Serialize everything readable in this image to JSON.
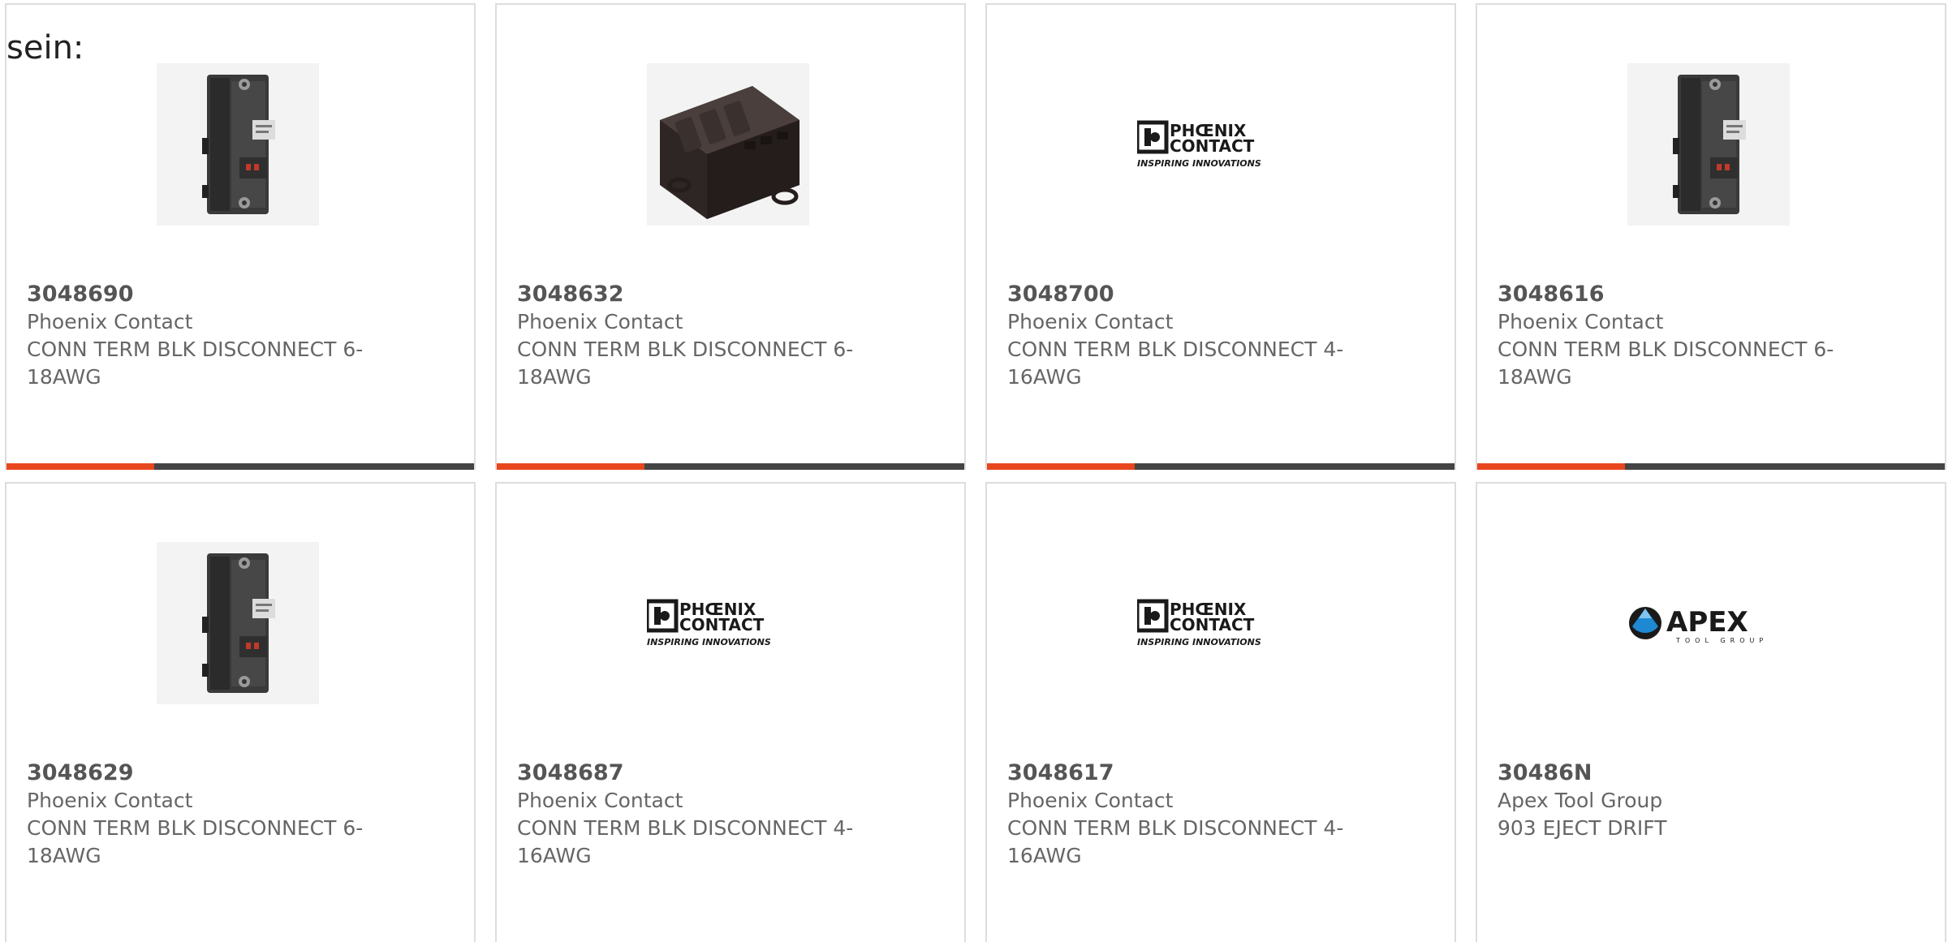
{
  "lead_text": "sein:",
  "colors": {
    "accent": "#e8461e",
    "bar": "#444444",
    "text": "#666666",
    "border": "#dddddd"
  },
  "logos": {
    "phoenix_line1": "PHŒNIX",
    "phoenix_line2": "CONTACT",
    "phoenix_tagline": "INSPIRING INNOVATIONS",
    "apex_name": "APEX",
    "apex_tagline": "TOOL GROUP"
  },
  "products": [
    {
      "part_number": "3048690",
      "manufacturer": "Phoenix Contact",
      "description": "CONN TERM BLK DISCONNECT 6-18AWG",
      "image": "single-disconnect-photo"
    },
    {
      "part_number": "3048632",
      "manufacturer": "Phoenix Contact",
      "description": "CONN TERM BLK DISCONNECT 6-18AWG",
      "image": "triple-disconnect-photo"
    },
    {
      "part_number": "3048700",
      "manufacturer": "Phoenix Contact",
      "description": "CONN TERM BLK DISCONNECT 4-16AWG",
      "image": "phoenix-contact-logo"
    },
    {
      "part_number": "3048616",
      "manufacturer": "Phoenix Contact",
      "description": "CONN TERM BLK DISCONNECT 6-18AWG",
      "image": "single-disconnect-photo"
    },
    {
      "part_number": "3048629",
      "manufacturer": "Phoenix Contact",
      "description": "CONN TERM BLK DISCONNECT 6-18AWG",
      "image": "single-disconnect-photo"
    },
    {
      "part_number": "3048687",
      "manufacturer": "Phoenix Contact",
      "description": "CONN TERM BLK DISCONNECT 4-16AWG",
      "image": "phoenix-contact-logo"
    },
    {
      "part_number": "3048617",
      "manufacturer": "Phoenix Contact",
      "description": "CONN TERM BLK DISCONNECT 4-16AWG",
      "image": "phoenix-contact-logo"
    },
    {
      "part_number": "30486N",
      "manufacturer": "Apex Tool Group",
      "description": "903 EJECT DRIFT",
      "image": "apex-tool-group-logo"
    }
  ]
}
